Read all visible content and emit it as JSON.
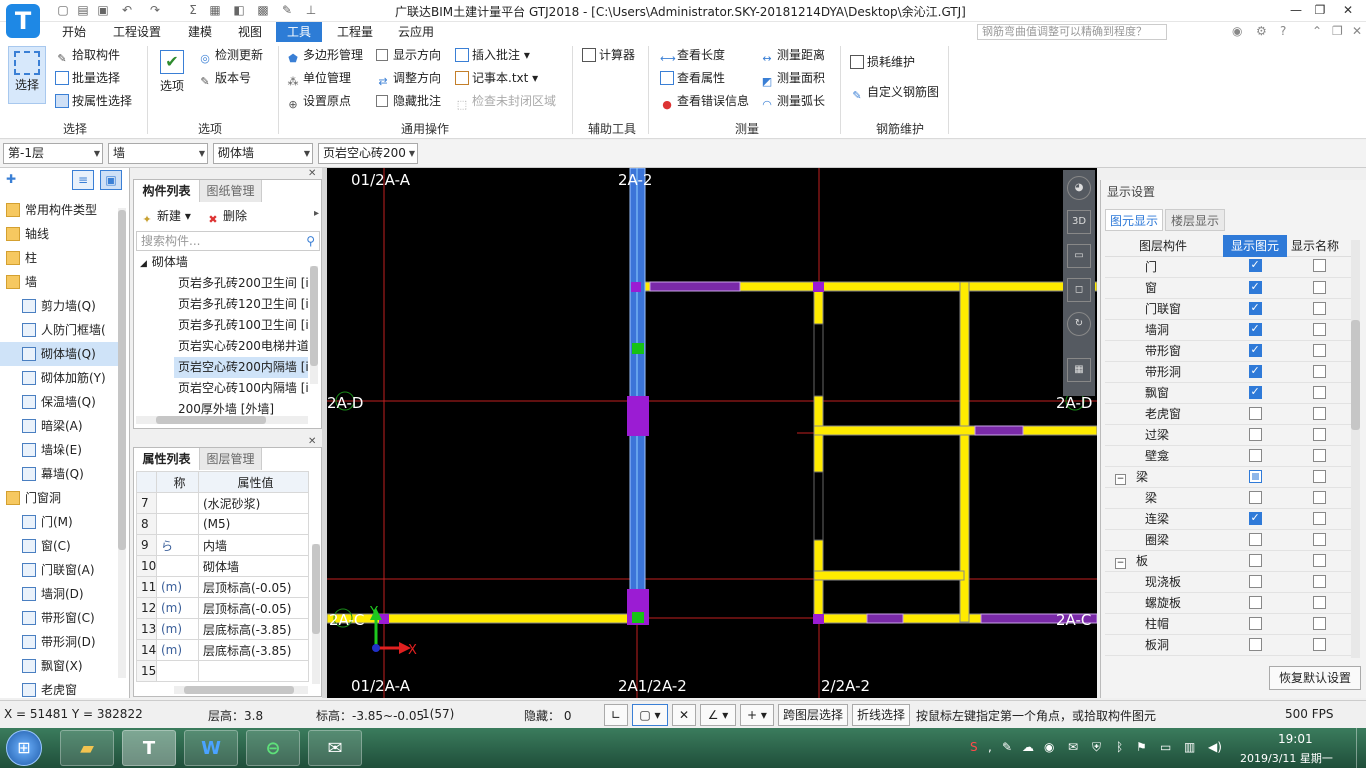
{
  "window": {
    "title": "广联达BIM土建计量平台 GTJ2018 - [C:\\Users\\Administrator.SKY-20181214DYA\\Desktop\\余沁江.GTJ]",
    "search_placeholder": "钢筋弯曲值调整可以精确到程度？",
    "logo_letter": "T"
  },
  "menus": [
    "开始",
    "工程设置",
    "建模",
    "视图",
    "工具",
    "工程量",
    "云应用"
  ],
  "active_menu": "工具",
  "ribbon": {
    "groups": [
      {
        "label": "选择",
        "big": "选择",
        "items": [
          "拾取构件",
          "批量选择",
          "按属性选择"
        ]
      },
      {
        "label": "选项",
        "big": "选项",
        "items": [
          "检测更新",
          "版本号"
        ]
      },
      {
        "label": "通用操作",
        "items": [
          "多边形管理",
          "单位管理",
          "设置原点",
          "显示方向",
          "调整方向",
          "隐藏批注",
          "插入批注",
          "记事本.txt",
          "检查未封闭区域"
        ]
      },
      {
        "label": "辅助工具",
        "items": [
          "计算器"
        ]
      },
      {
        "label": "测量",
        "items": [
          "查看长度",
          "查看属性",
          "查看错误信息",
          "测量距离",
          "测量面积",
          "测量弧长"
        ]
      },
      {
        "label": "钢筋维护",
        "items": [
          "损耗维护",
          "自定义钢筋图"
        ]
      }
    ]
  },
  "selectors": {
    "floor": "第-1层",
    "category": "墙",
    "type": "砌体墙",
    "component": "页岩空心砖200"
  },
  "nav": {
    "items": [
      {
        "label": "常用构件类型",
        "folder": true
      },
      {
        "label": "轴线",
        "folder": true
      },
      {
        "label": "柱",
        "folder": true
      },
      {
        "label": "墙",
        "folder": true
      },
      {
        "label": "剪力墙(Q)"
      },
      {
        "label": "人防门框墙("
      },
      {
        "label": "砌体墙(Q)",
        "selected": true
      },
      {
        "label": "砌体加筋(Y)"
      },
      {
        "label": "保温墙(Q)"
      },
      {
        "label": "暗梁(A)"
      },
      {
        "label": "墙垛(E)"
      },
      {
        "label": "幕墙(Q)"
      },
      {
        "label": "门窗洞",
        "folder": true
      },
      {
        "label": "门(M)"
      },
      {
        "label": "窗(C)"
      },
      {
        "label": "门联窗(A)"
      },
      {
        "label": "墙洞(D)"
      },
      {
        "label": "带形窗(C)"
      },
      {
        "label": "带形洞(D)"
      },
      {
        "label": "飘窗(X)"
      },
      {
        "label": "老虎窗"
      }
    ]
  },
  "component_list": {
    "tabs": [
      "构件列表",
      "图纸管理"
    ],
    "new_label": "新建",
    "delete_label": "删除",
    "search_placeholder": "搜索构件...",
    "group": "砌体墙",
    "items": [
      {
        "label": "页岩多孔砖200卫生间 [i"
      },
      {
        "label": "页岩多孔砖120卫生间 [i"
      },
      {
        "label": "页岩多孔砖100卫生间 [i"
      },
      {
        "label": "页岩实心砖200电梯井道"
      },
      {
        "label": "页岩空心砖200内隔墙 [i",
        "selected": true
      },
      {
        "label": "页岩空心砖100内隔墙 [i"
      },
      {
        "label": "200厚外墙 [外墙]"
      }
    ]
  },
  "property_list": {
    "tabs": [
      "属性列表",
      "图层管理"
    ],
    "headers": [
      "称",
      "属性值"
    ],
    "rows": [
      {
        "no": "7",
        "name": "",
        "value": "(水泥砂浆)"
      },
      {
        "no": "8",
        "name": "",
        "value": "(M5)"
      },
      {
        "no": "9",
        "name": "ら",
        "value": "内墙"
      },
      {
        "no": "10",
        "name": "",
        "value": "砌体墙"
      },
      {
        "no": "11",
        "name": "(m)",
        "value": "层顶标高(-0.05)"
      },
      {
        "no": "12",
        "name": "(m)",
        "value": "层顶标高(-0.05)"
      },
      {
        "no": "13",
        "name": "(m)",
        "value": "层底标高(-3.85)"
      },
      {
        "no": "14",
        "name": "(m)",
        "value": "层底标高(-3.85)"
      },
      {
        "no": "15",
        "name": "",
        "value": ""
      }
    ]
  },
  "canvas": {
    "labels": {
      "top_left": "01/2A-A",
      "top_mid": "2A-2",
      "left_mid": "2A-D",
      "right_mid": "2A-D",
      "left_bottom": "2A-C",
      "right_bottom": "2A-C",
      "bottom_left": "01/2A-A",
      "bottom_mid": "2A1/2A-2",
      "bottom_right": "2/2A-2",
      "axis_x": "X",
      "axis_y": "Y"
    }
  },
  "display_settings": {
    "title": "显示设置",
    "tabs": [
      "图元显示",
      "楼层显示"
    ],
    "headers": [
      "图层构件",
      "显示图元",
      "显示名称"
    ],
    "rows": [
      {
        "label": "门",
        "indent": true,
        "show": "on",
        "name": "off"
      },
      {
        "label": "窗",
        "indent": true,
        "show": "on",
        "name": "off"
      },
      {
        "label": "门联窗",
        "indent": true,
        "show": "on",
        "name": "off"
      },
      {
        "label": "墙洞",
        "indent": true,
        "show": "on",
        "name": "off"
      },
      {
        "label": "带形窗",
        "indent": true,
        "show": "on",
        "name": "off"
      },
      {
        "label": "带形洞",
        "indent": true,
        "show": "on",
        "name": "off"
      },
      {
        "label": "飘窗",
        "indent": true,
        "show": "on",
        "name": "off"
      },
      {
        "label": "老虎窗",
        "indent": true,
        "show": "off",
        "name": "off"
      },
      {
        "label": "过梁",
        "indent": true,
        "show": "off",
        "name": "off"
      },
      {
        "label": "壁龛",
        "indent": true,
        "show": "off",
        "name": "off"
      },
      {
        "label": "梁",
        "indent": false,
        "show": "part",
        "name": "off"
      },
      {
        "label": "梁",
        "indent": true,
        "show": "off",
        "name": "off"
      },
      {
        "label": "连梁",
        "indent": true,
        "show": "on",
        "name": "off"
      },
      {
        "label": "圈梁",
        "indent": true,
        "show": "off",
        "name": "off"
      },
      {
        "label": "板",
        "indent": false,
        "show": "off",
        "name": "off"
      },
      {
        "label": "现浇板",
        "indent": true,
        "show": "off",
        "name": "off"
      },
      {
        "label": "螺旋板",
        "indent": true,
        "show": "off",
        "name": "off"
      },
      {
        "label": "柱帽",
        "indent": true,
        "show": "off",
        "name": "off"
      },
      {
        "label": "板洞",
        "indent": true,
        "show": "off",
        "name": "off"
      }
    ],
    "restore_label": "恢复默认设置"
  },
  "status": {
    "coords": "X = 51481 Y = 382822",
    "floor_height": "层高：3.8",
    "elevation": "标高：-3.85~-0.05",
    "count": "1(57)",
    "hidden": "隐藏： 0",
    "cross_floor": "跨图层选择",
    "polyline": "折线选择",
    "hint": "按鼠标左键指定第一个角点，或拾取构件图元",
    "fps": "500 FPS"
  },
  "taskbar": {
    "time": "19:01",
    "date": "2019/3/11 星期一"
  }
}
